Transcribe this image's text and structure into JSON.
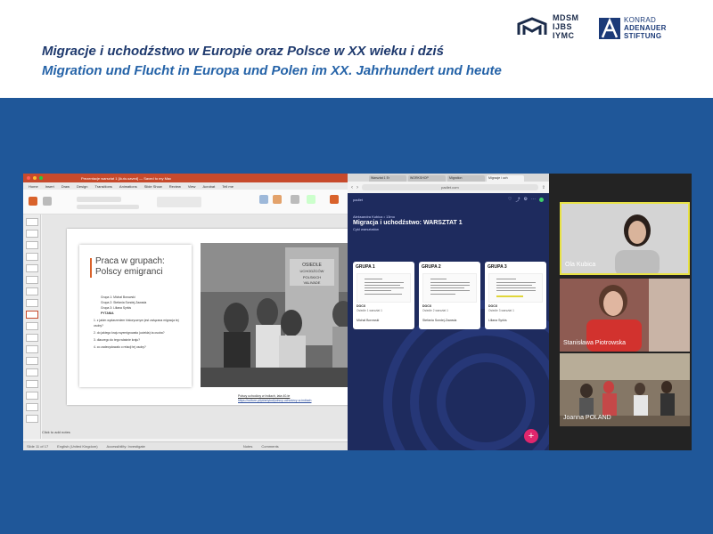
{
  "header": {
    "title_pl": "Migracje i uchodźstwo w Europie oraz Polsce w XX wieku i dziś",
    "title_de": "Migration und Flucht in Europa und Polen im XX. Jahrhundert und heute",
    "logo_mdsm": [
      "MDSM",
      "IJBS",
      "IYMC"
    ],
    "logo_kas": [
      "KONRAD",
      "ADENAUER",
      "STIFTUNG"
    ]
  },
  "powerpoint": {
    "window_title": "Prezentacje warsztat 1 [Auto-saved] — Saved to my Mac",
    "menu": [
      "Home",
      "Insert",
      "Draw",
      "Design",
      "Transitions",
      "Animations",
      "Slide Show",
      "Review",
      "View",
      "Acrobat",
      "Tell me"
    ],
    "slide": {
      "title_line1": "Praca w grupach:",
      "title_line2": "Polscy emigranci",
      "bullets": [
        "Grupa 1: Michał Borowski",
        "Grupa 2: Stefania Sondej-Zawada",
        "Grupa 3: Liliana Syrkis",
        "PYTANIA",
        "1. z jakim wydarzeniem historycznym jest związana migracja tej osoby?",
        "2. do jakiego kraju wyemigrowała (uciekła) ta osoba?",
        "3. dlaczego do tego właśnie kraju?",
        "4. co zadecydowało o relacji tej osoby?"
      ],
      "photo_sign": "OSIEDLE UCHODŹCÓW POLSKICH VALIVADE",
      "caption_line1": "Polscy uchodźcy w Indiach, lata 40-te",
      "caption_line2": "https://culture.pl/pl/artykul/polscy-uchodzcy-w-indiach"
    },
    "notes_placeholder": "Click to add notes",
    "status": [
      "Slide 11 of 17",
      "English (United Kingdom)",
      "Accessibility: Investigate",
      "Notes",
      "Comments"
    ]
  },
  "browser": {
    "tabs": [
      "Warsztat 1 Er",
      "WORKSHOP",
      "Migration",
      "Migracje i uch"
    ],
    "url": "padlet.com"
  },
  "padlet": {
    "brand": "padlet",
    "author": "Aleksandra Kubica • 13mo",
    "title": "Migracja i uchodźstwo: WARSZTAT 1",
    "subtitle": "Cykl warsztatów",
    "columns": [
      {
        "header": "GRUPA 1",
        "type": "DOCX",
        "sub": "Osiedle 1 warsztat 1",
        "name": "Michał Borowski"
      },
      {
        "header": "GRUPA 2",
        "type": "DOCX",
        "sub": "Osiedle 2 warsztat 1",
        "name": "Stefania Sondej-Zawada"
      },
      {
        "header": "GRUPA 3",
        "type": "DOCX",
        "sub": "Osiedle 3 warsztat 1",
        "name": "Liliana Syrkis"
      }
    ],
    "fab": "+"
  },
  "participants": [
    {
      "name": "Ola Kubica"
    },
    {
      "name": "Stanisława Piotrowska"
    },
    {
      "name": "Joanna POLAND"
    }
  ],
  "colors": {
    "header_bg": "#ffffff",
    "title_pl": "#1f3a6e",
    "title_de": "#2563a8",
    "page_blue": "#1f5799",
    "padlet_bg": "#1e2b5e",
    "accent_orange": "#d9622b",
    "fab_pink": "#e0266d"
  }
}
